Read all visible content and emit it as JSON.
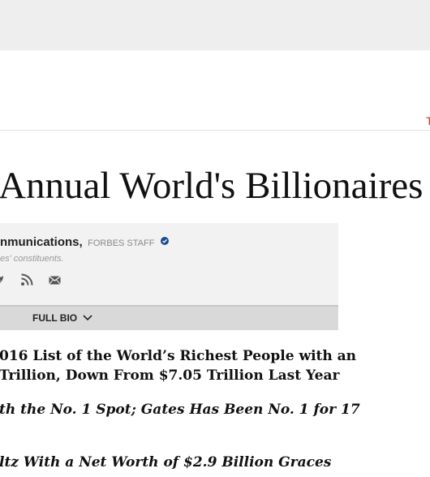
{
  "header": {
    "edge_letter": "T"
  },
  "article": {
    "headline": "Annual World's Billionaires"
  },
  "author": {
    "name": "nmunications,",
    "staff_label": "FORBES STAFF",
    "description": "es' constituents.",
    "bio_toggle_label": "FULL BIO",
    "social_icons": [
      "twitter-icon",
      "rss-icon",
      "email-icon"
    ]
  },
  "bullets": [
    {
      "line1": "016 List of the World’s Richest People with an",
      "line2": " Trillion, Down From $7.05 Trillion Last Year"
    },
    {
      "line1": "th the No. 1 Spot; Gates Has Been No. 1 for 17"
    },
    {
      "line1": "ltz With a Net Worth of $2.9 Billion Graces"
    }
  ],
  "colors": {
    "top_band": "#eeeeee",
    "author_box": "#f2f2f2",
    "bio_bar": "#d9d9d9",
    "accent_red": "#c0392b",
    "verified_blue": "#1a4c8b"
  }
}
